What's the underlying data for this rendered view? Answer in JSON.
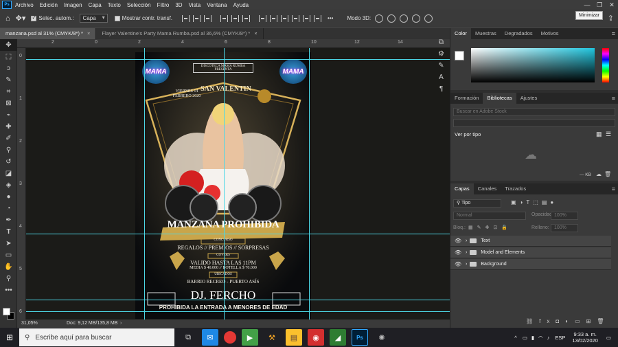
{
  "menu": {
    "items": [
      "Archivo",
      "Edición",
      "Imagen",
      "Capa",
      "Texto",
      "Selección",
      "Filtro",
      "3D",
      "Vista",
      "Ventana",
      "Ayuda"
    ]
  },
  "window": {
    "minimize_tooltip": "Minimizar"
  },
  "options": {
    "auto_select_label": "Selec. autom.:",
    "auto_select_value": "Capa",
    "show_transform_label": "Mostrar contr. transf.",
    "mode3d_label": "Modo 3D:"
  },
  "tabs": [
    {
      "label": "manzana.psd al 31% (CMYK/8*) *",
      "close": "×"
    },
    {
      "label": "Flayer  Valentine's Party Mama Rumba.psd al 36,6% (CMYK/8*) *",
      "close": "×"
    }
  ],
  "rulers": {
    "h": [
      "2",
      "0",
      "2",
      "4",
      "6",
      "8",
      "10",
      "12",
      "14"
    ],
    "v": [
      "0",
      "1",
      "2",
      "3",
      "4",
      "5",
      "6"
    ]
  },
  "flyer": {
    "logo": "MAMA",
    "top_text": "DISCOTECA MAMA RUMBA PRESENTA",
    "date": "VIERNES 14 FEBRERO 2020",
    "event": "SAN VALENTIN",
    "title": "MANZANA PROHIBIDA",
    "contest": "CONCURSO",
    "prizes": "REGALOS // PREMIOS // SORPRESAS",
    "covers": "COVERS",
    "valid": "VALIDO HASTA LAS 11PM",
    "prices": "MEDIA $ 40.000 // BOTELLA $ 70.000",
    "location_label": "UBICADOS",
    "location": "BARRIO RECREO - PUERTO ASÍS",
    "dj": "DJ. FERCHO",
    "footer": "PROHIBIDA LA ENTRADA  A MENORES DE EDAD"
  },
  "status": {
    "zoom": "31,05%",
    "doc": "Doc: 9,12 MB/135,8 MB"
  },
  "color_panel": {
    "tabs": [
      "Color",
      "Muestras",
      "Degradados",
      "Motivos"
    ]
  },
  "lib_panel": {
    "tabs": [
      "Formación",
      "Bibliotecas",
      "Ajustes"
    ],
    "search_placeholder": "Buscar en Adobe Stock",
    "view_by": "Ver por tipo",
    "size": "— KB"
  },
  "layers_panel": {
    "tabs": [
      "Capas",
      "Canales",
      "Trazados"
    ],
    "filter": "Tipo",
    "blend": "Normal",
    "opacity_label": "Opacidad:",
    "opacity": "100%",
    "lock_label": "Bloq.:",
    "fill_label": "Relleno:",
    "fill": "100%",
    "layers": [
      "Text",
      "Model and Elements",
      "Background"
    ]
  },
  "taskbar": {
    "search": "Escribe aquí para buscar",
    "lang": "ESP",
    "time": "9:33 a. m.",
    "date": "13/02/2020"
  }
}
